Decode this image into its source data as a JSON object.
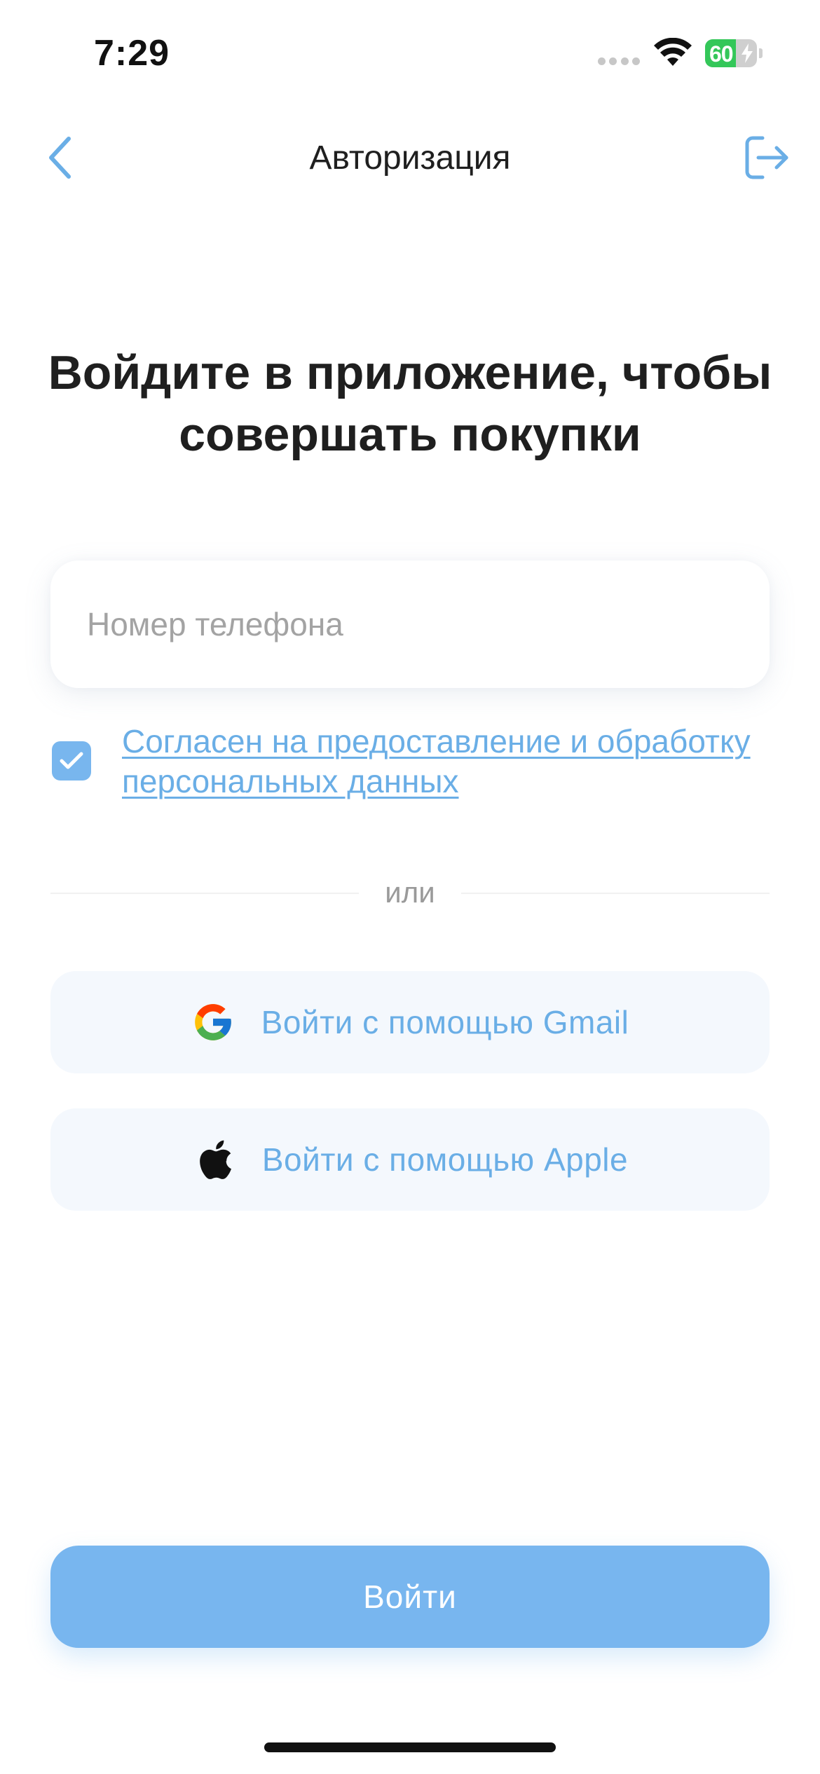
{
  "status_bar": {
    "time": "7:29",
    "battery_level": "60",
    "battery_fraction": 0.6
  },
  "header": {
    "title": "Авторизация",
    "back_icon": "chevron-left-icon",
    "logout_icon": "logout-icon"
  },
  "main": {
    "headline": "Войдите в приложение, чтобы совершать покупки",
    "phone_input": {
      "value": "",
      "placeholder": "Номер телефона"
    },
    "consent": {
      "checked": true,
      "label": "Согласен на предоставление и обработку персональных данных"
    },
    "divider_text": "или",
    "social": {
      "gmail_label": "Войти с помощью Gmail",
      "apple_label": "Войти с помощью Apple"
    },
    "login_label": "Войти"
  },
  "colors": {
    "accent": "#78b6ef",
    "link": "#6aaee6",
    "social_bg": "#f4f8fd",
    "battery_green": "#34c759"
  }
}
